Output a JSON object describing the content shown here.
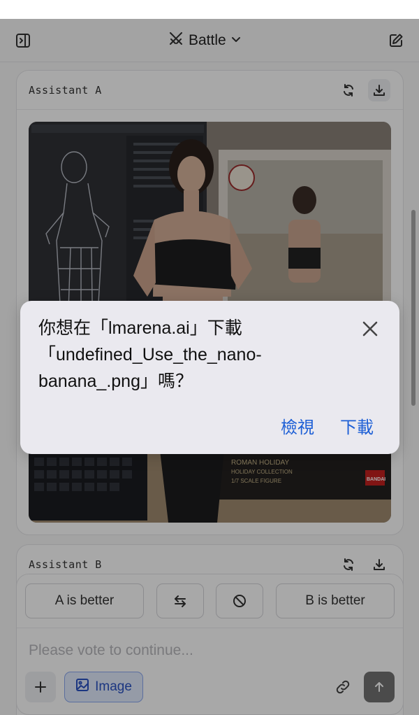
{
  "header": {
    "title": "Battle",
    "icons": {
      "sidebar": "sidebar-toggle-icon",
      "mode": "swords-icon",
      "chevron": "chevron-down-icon",
      "new_chat": "edit-icon"
    }
  },
  "assistant_a": {
    "name": "Assistant A",
    "icons": {
      "refresh": "refresh-icon",
      "download": "download-icon"
    }
  },
  "assistant_b": {
    "name": "Assistant B",
    "icons": {
      "refresh": "refresh-icon",
      "download": "download-icon"
    }
  },
  "vote": {
    "a_better": "A is better",
    "b_better": "B is better",
    "icons": {
      "swap": "swap-arrows-icon",
      "tie": "prohibited-icon"
    }
  },
  "composer": {
    "placeholder": "Please vote to continue...",
    "image_label": "Image",
    "icons": {
      "add": "plus-icon",
      "image": "image-icon",
      "link": "link-icon",
      "send": "arrow-up-icon"
    }
  },
  "download_dialog": {
    "message": "你想在「lmarena.ai」下載\n「undefined_Use_the_nano-\nbanana_.png」嗎？",
    "view_label": "檢視",
    "download_label": "下載",
    "icons": {
      "close": "close-icon"
    }
  },
  "photo": {
    "box_text": {
      "holiday": "ROMAN HOLIDAY",
      "collection": "HOLIDAY COLLECTION",
      "scale": "1/7 SCALE FIGURE",
      "brand": "BANDAI"
    }
  },
  "colors": {
    "accent": "#1d5fd6",
    "image_button_bg": "#e3ebfd",
    "send_button": "#737373"
  }
}
